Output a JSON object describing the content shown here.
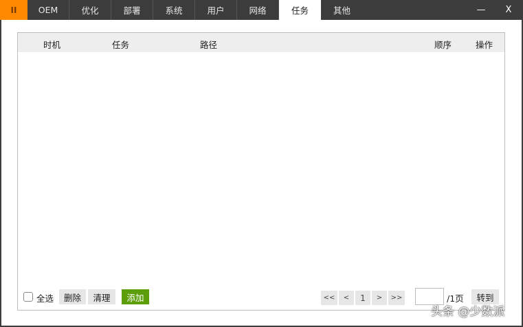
{
  "tabs": {
    "logo": "II",
    "items": [
      "OEM",
      "优化",
      "部署",
      "系统",
      "用户",
      "网络",
      "任务",
      "其他"
    ],
    "active": "任务"
  },
  "window": {
    "minimize": "—",
    "close": "X"
  },
  "table": {
    "columns": [
      "时机",
      "任务",
      "路径",
      "顺序",
      "操作"
    ],
    "rows": []
  },
  "footer": {
    "select_all": "全选",
    "delete": "删除",
    "clear": "清理",
    "add": "添加"
  },
  "pagination": {
    "first": "<<",
    "prev": "<",
    "current": "1",
    "next": ">",
    "last": ">>",
    "page_input": "",
    "total": "/1页",
    "goto": "转到"
  },
  "watermark": "头条 @少数派",
  "colors": {
    "accent": "#ff8a00",
    "add_button": "#5c9e0a",
    "titlebar": "#3c3c3c"
  }
}
